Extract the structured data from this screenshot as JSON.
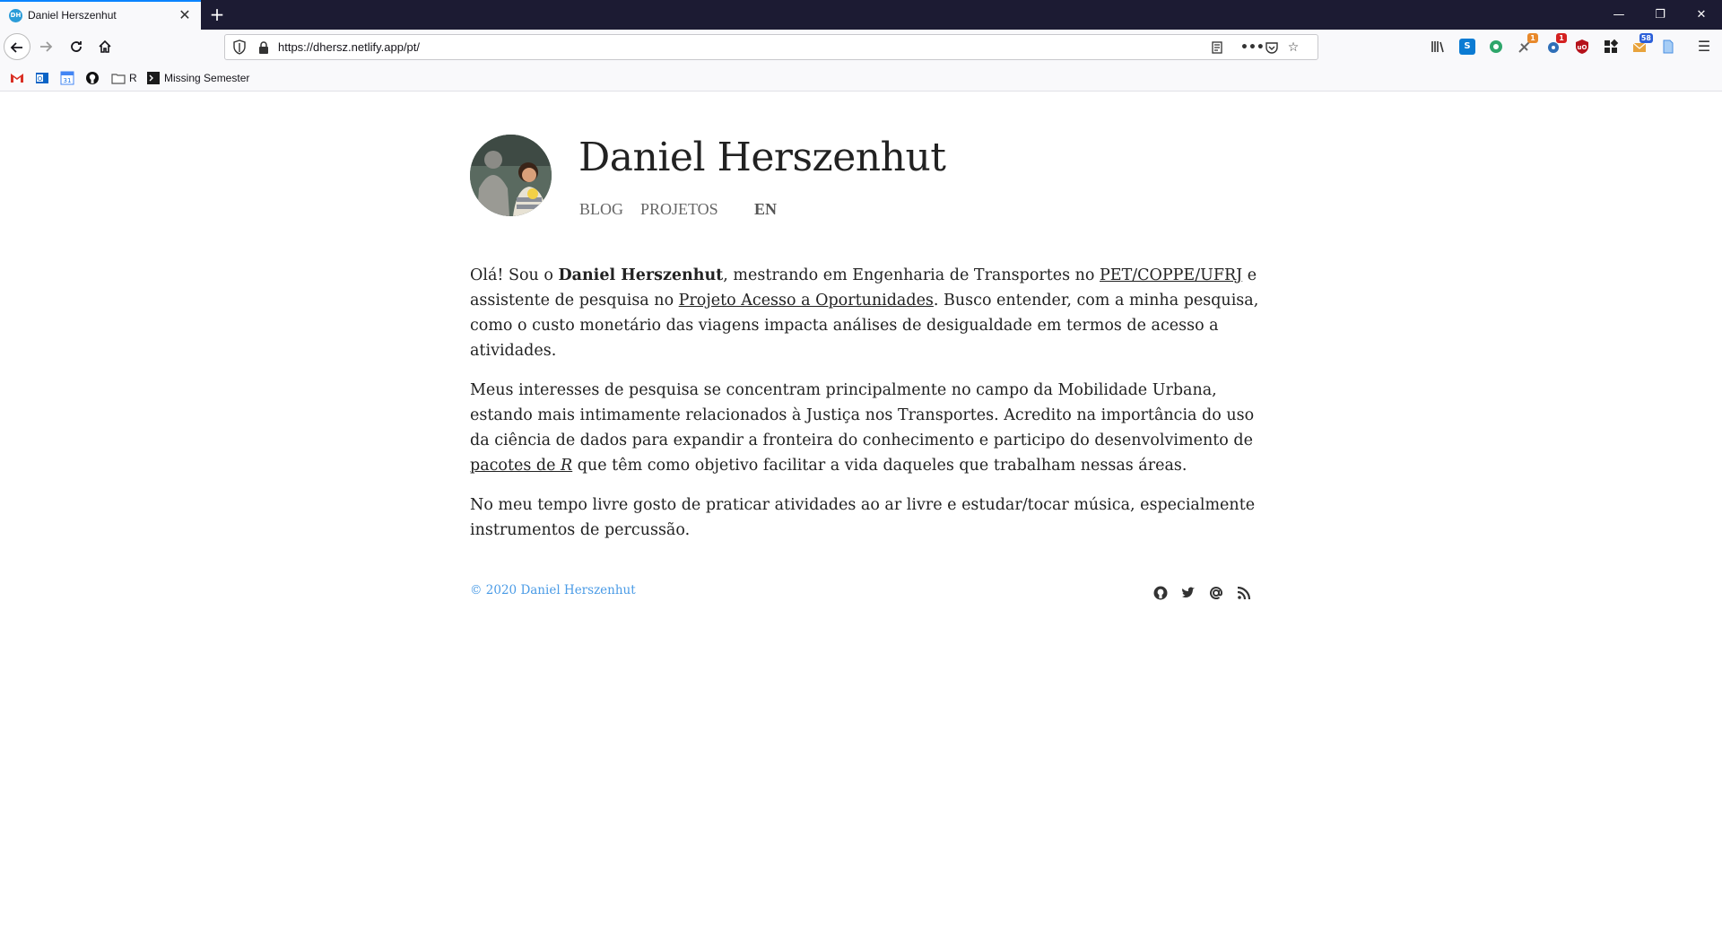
{
  "browser": {
    "tab": {
      "title": "Daniel Herszenhut",
      "favicon_text": "DH"
    },
    "url": "https://dhersz.netlify.app/pt/",
    "extensions": [
      {
        "name": "library-icon",
        "color": "#333333",
        "badge": ""
      },
      {
        "name": "s-extension-icon",
        "color": "#0b7bd3",
        "badge": ""
      },
      {
        "name": "green-extension-icon",
        "color": "#2ea66b",
        "badge": ""
      },
      {
        "name": "satellite-extension-icon",
        "color": "#666666",
        "badge": "1"
      },
      {
        "name": "gear-extension-icon",
        "color": "#2f6fb8",
        "badge": "1"
      },
      {
        "name": "ublock-icon",
        "color": "#b5121b",
        "badge": ""
      },
      {
        "name": "apps-extension-icon",
        "color": "#222222",
        "badge": ""
      },
      {
        "name": "mail-extension-icon",
        "color": "#e8a33c",
        "badge": "58"
      },
      {
        "name": "doc-extension-icon",
        "color": "#4a90e2",
        "badge": ""
      }
    ]
  },
  "bookmarks": {
    "folder_label": "R",
    "missing_semester": "Missing Semester"
  },
  "site": {
    "title": "Daniel Herszenhut",
    "nav": {
      "blog": "BLOG",
      "projects": "PROJETOS",
      "lang": "EN"
    },
    "paragraphs": {
      "p1": {
        "t1": "Olá! Sou o ",
        "name": "Daniel Herszenhut",
        "t2": ", mestrando em Engenharia de Transportes no ",
        "link1": "PET/COPPE/UFRJ",
        "t3": " e assistente de pesquisa no ",
        "link2": "Projeto Acesso a Oportunidades",
        "t4": ". Busco entender, com a minha pesquisa, como o custo monetário das viagens impacta análises de desigualdade em termos de acesso a atividades."
      },
      "p2": {
        "t1": "Meus interesses de pesquisa se concentram principalmente no campo da Mobilidade Urbana, estando mais intimamente relacionados à Justiça nos Transportes. Acredito na importância do uso da ciência de dados para expandir a fronteira do conhecimento e participo do desenvolvimento de ",
        "link_text": "pacotes de ",
        "link_em": "R",
        "t2": " que têm como objetivo facilitar a vida daqueles que trabalham nessas áreas."
      },
      "p3": "No meu tempo livre gosto de praticar atividades ao ar livre e estudar/tocar música, especialmente instrumentos de percussão."
    },
    "footer": {
      "copyright": "© 2020 Daniel Herszenhut"
    }
  },
  "colors": {
    "accent": "#4a9be6",
    "tabstrip": "#1c1b33"
  }
}
